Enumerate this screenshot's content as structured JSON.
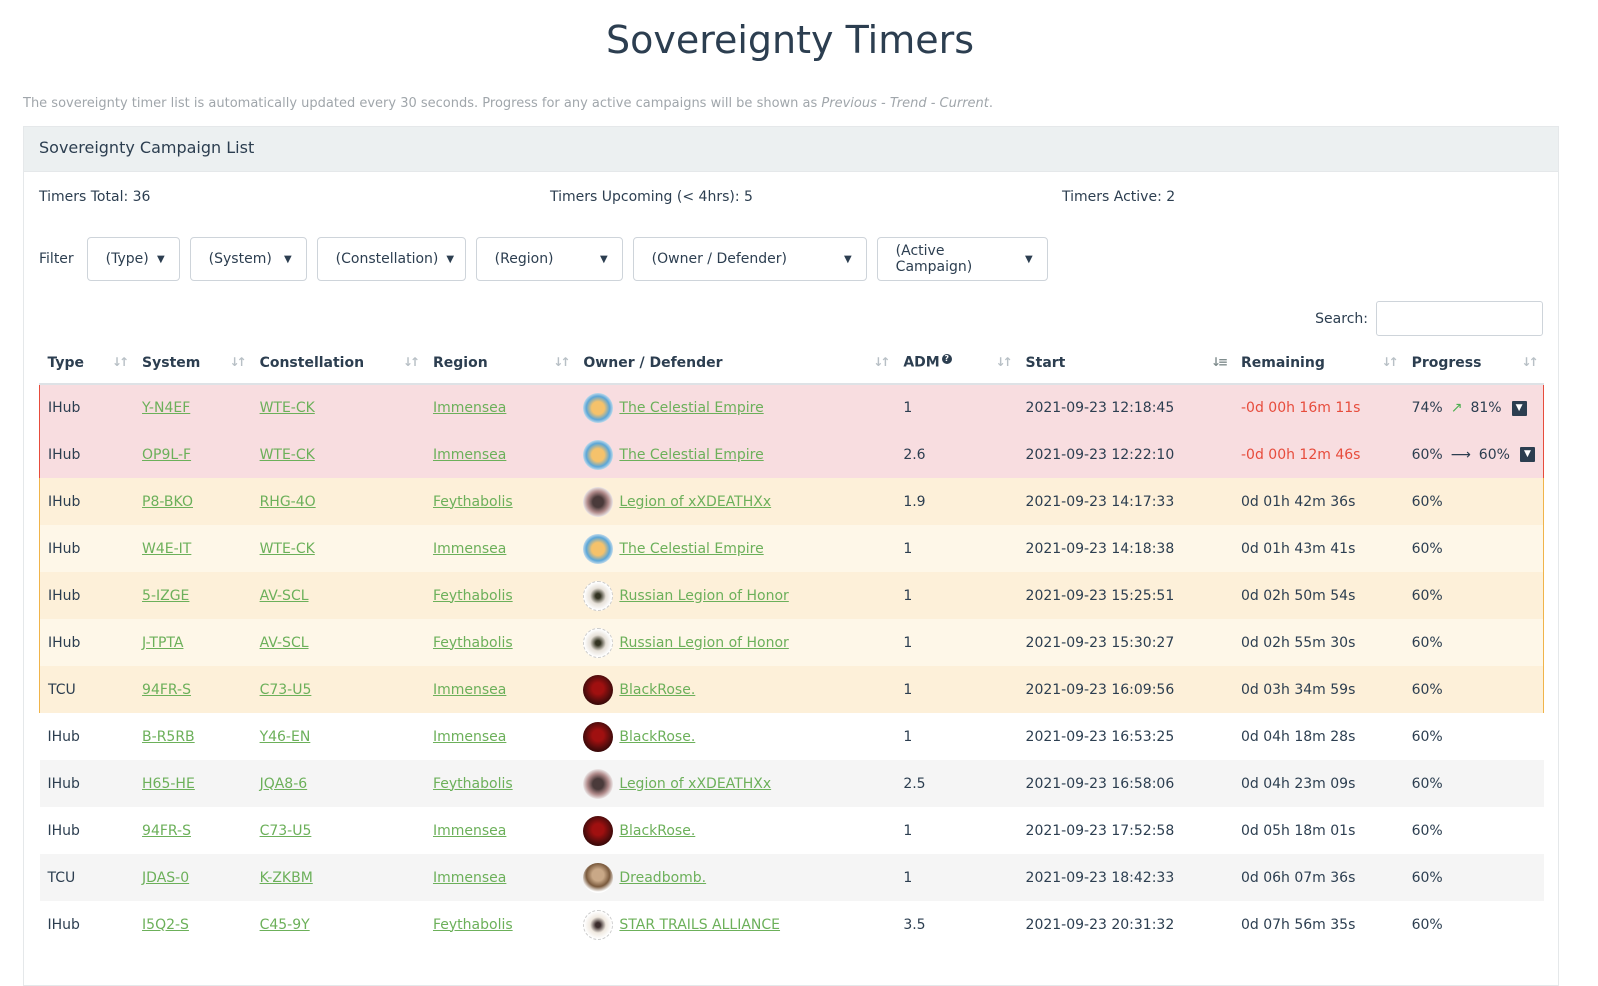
{
  "page": {
    "title": "Sovereignty Timers",
    "intro_prefix": "The sovereignty timer list is automatically updated every 30 seconds. Progress for any active campaigns will be shown as ",
    "intro_italic": "Previous - Trend - Current",
    "intro_suffix": "."
  },
  "card": {
    "header": "Sovereignty Campaign List",
    "timers_total": "Timers Total: 36",
    "timers_upcoming": "Timers Upcoming (< 4hrs): 5",
    "timers_active": "Timers Active: 2"
  },
  "filters": {
    "label": "Filter",
    "type": "(Type)",
    "system": "(System)",
    "constellation": "(Constellation)",
    "region": "(Region)",
    "owner": "(Owner / Defender)",
    "active": "(Active Campaign)"
  },
  "search": {
    "label": "Search:",
    "value": ""
  },
  "columns": {
    "type": "Type",
    "system": "System",
    "constellation": "Constellation",
    "region": "Region",
    "owner": "Owner / Defender",
    "adm": "ADM",
    "start": "Start",
    "remaining": "Remaining",
    "progress": "Progress"
  },
  "rows": [
    {
      "type": "IHub",
      "system": "Y-N4EF",
      "constellation": "WTE-CK",
      "region": "Immensea",
      "owner": "The Celestial Empire",
      "logo": "celestial",
      "adm": "1",
      "start": "2021-09-23 12:18:45",
      "remaining": "-0d 00h 16m 11s",
      "prev": "74%",
      "trend": "up",
      "current": "81%",
      "state": "active"
    },
    {
      "type": "IHub",
      "system": "OP9L-F",
      "constellation": "WTE-CK",
      "region": "Immensea",
      "owner": "The Celestial Empire",
      "logo": "celestial",
      "adm": "2.6",
      "start": "2021-09-23 12:22:10",
      "remaining": "-0d 00h 12m 46s",
      "prev": "60%",
      "trend": "flat",
      "current": "60%",
      "state": "active"
    },
    {
      "type": "IHub",
      "system": "P8-BKO",
      "constellation": "RHG-4O",
      "region": "Feythabolis",
      "owner": "Legion of xXDEATHXx",
      "logo": "legion",
      "adm": "1.9",
      "start": "2021-09-23 14:17:33",
      "remaining": "0d 01h 42m 36s",
      "progress": "60%",
      "state": "upcoming-odd"
    },
    {
      "type": "IHub",
      "system": "W4E-IT",
      "constellation": "WTE-CK",
      "region": "Immensea",
      "owner": "The Celestial Empire",
      "logo": "celestial",
      "adm": "1",
      "start": "2021-09-23 14:18:38",
      "remaining": "0d 01h 43m 41s",
      "progress": "60%",
      "state": "upcoming-even"
    },
    {
      "type": "IHub",
      "system": "5-IZGE",
      "constellation": "AV-SCL",
      "region": "Feythabolis",
      "owner": "Russian Legion of Honor",
      "logo": "russian",
      "adm": "1",
      "start": "2021-09-23 15:25:51",
      "remaining": "0d 02h 50m 54s",
      "progress": "60%",
      "state": "upcoming-odd"
    },
    {
      "type": "IHub",
      "system": "J-TPTA",
      "constellation": "AV-SCL",
      "region": "Feythabolis",
      "owner": "Russian Legion of Honor",
      "logo": "russian",
      "adm": "1",
      "start": "2021-09-23 15:30:27",
      "remaining": "0d 02h 55m 30s",
      "progress": "60%",
      "state": "upcoming-even"
    },
    {
      "type": "TCU",
      "system": "94FR-S",
      "constellation": "C73-U5",
      "region": "Immensea",
      "owner": "BlackRose.",
      "logo": "blackrose",
      "adm": "1",
      "start": "2021-09-23 16:09:56",
      "remaining": "0d 03h 34m 59s",
      "progress": "60%",
      "state": "upcoming-odd"
    },
    {
      "type": "IHub",
      "system": "B-R5RB",
      "constellation": "Y46-EN",
      "region": "Immensea",
      "owner": "BlackRose.",
      "logo": "blackrose",
      "adm": "1",
      "start": "2021-09-23 16:53:25",
      "remaining": "0d 04h 18m 28s",
      "progress": "60%",
      "state": "normal-odd"
    },
    {
      "type": "IHub",
      "system": "H65-HE",
      "constellation": "JQA8-6",
      "region": "Feythabolis",
      "owner": "Legion of xXDEATHXx",
      "logo": "legion",
      "adm": "2.5",
      "start": "2021-09-23 16:58:06",
      "remaining": "0d 04h 23m 09s",
      "progress": "60%",
      "state": "normal-even"
    },
    {
      "type": "IHub",
      "system": "94FR-S",
      "constellation": "C73-U5",
      "region": "Immensea",
      "owner": "BlackRose.",
      "logo": "blackrose",
      "adm": "1",
      "start": "2021-09-23 17:52:58",
      "remaining": "0d 05h 18m 01s",
      "progress": "60%",
      "state": "normal-odd"
    },
    {
      "type": "TCU",
      "system": "JDAS-0",
      "constellation": "K-ZKBM",
      "region": "Immensea",
      "owner": "Dreadbomb.",
      "logo": "dreadbomb",
      "adm": "1",
      "start": "2021-09-23 18:42:33",
      "remaining": "0d 06h 07m 36s",
      "progress": "60%",
      "state": "normal-even"
    },
    {
      "type": "IHub",
      "system": "I5Q2-S",
      "constellation": "C45-9Y",
      "region": "Feythabolis",
      "owner": "STAR TRAILS ALLIANCE",
      "logo": "star",
      "adm": "3.5",
      "start": "2021-09-23 20:31:32",
      "remaining": "0d 07h 56m 35s",
      "progress": "60%",
      "state": "normal-odd"
    }
  ],
  "icons": {
    "sort": "sort-icon",
    "sort_active": "sort-desc-icon",
    "trend_up": "trend-up-icon",
    "trend_flat": "arrow-right-icon",
    "expand": "caret-down-icon",
    "help": "question-icon"
  },
  "colors": {
    "link": "#6cb05a",
    "negative": "#e74c3c",
    "active_row": "#f8dde0",
    "upcoming_row": "#fdf0d9"
  }
}
